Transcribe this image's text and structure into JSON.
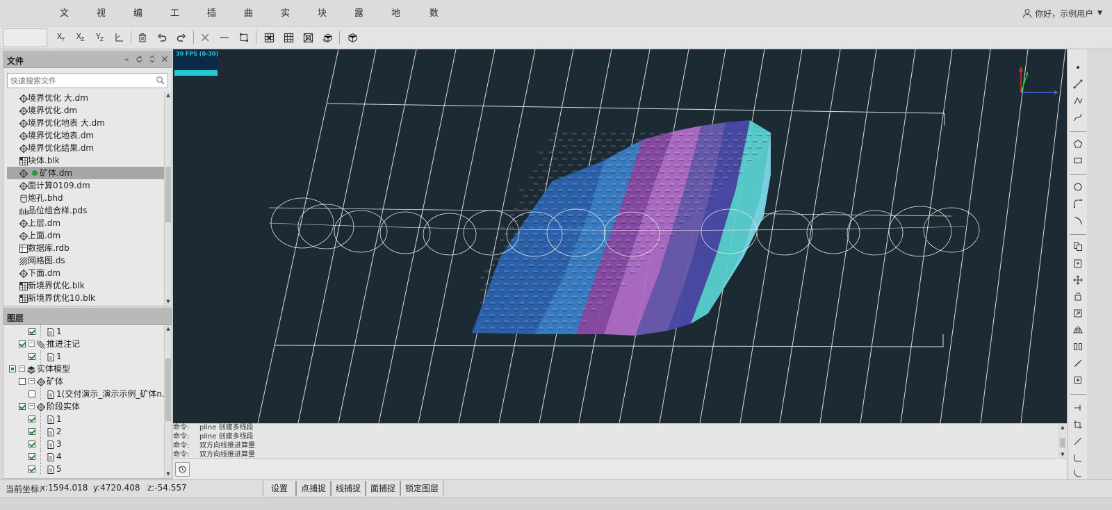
{
  "menu": {
    "items": [
      "文件",
      "视图",
      "编辑",
      "工具",
      "插入",
      "曲面",
      "实体",
      "块体",
      "露天",
      "地采",
      "数据库"
    ]
  },
  "user": {
    "greeting": "你好，示例用户"
  },
  "toolbar": {
    "buttons": [
      "xy-plane",
      "xz-plane",
      "yz-plane",
      "axis-toggle",
      "delete",
      "undo",
      "redo",
      "cross",
      "line",
      "rectangle-select",
      "view-grid",
      "grid",
      "box",
      "3d-rotate",
      "cube"
    ]
  },
  "file_panel": {
    "title": "文件",
    "search_placeholder": "快速搜索文件",
    "items": [
      {
        "name": "境界优化 大.dm",
        "icon": "dm-icon"
      },
      {
        "name": "境界优化.dm",
        "icon": "dm-icon"
      },
      {
        "name": "境界优化地表 大.dm",
        "icon": "dm-icon"
      },
      {
        "name": "境界优化地表.dm",
        "icon": "dm-icon"
      },
      {
        "name": "境界优化结果.dm",
        "icon": "dm-icon"
      },
      {
        "name": "块体.blk",
        "icon": "blk-icon"
      },
      {
        "name": "矿体.dm",
        "icon": "dm-icon",
        "selected": true,
        "active": true
      },
      {
        "name": "面计算0109.dm",
        "icon": "dm-icon"
      },
      {
        "name": "炮孔.bhd",
        "icon": "bhd-icon"
      },
      {
        "name": "品位组合样.pds",
        "icon": "pds-icon"
      },
      {
        "name": "上层.dm",
        "icon": "dm-icon"
      },
      {
        "name": "上面.dm",
        "icon": "dm-icon"
      },
      {
        "name": "数据库.rdb",
        "icon": "rdb-icon"
      },
      {
        "name": "网格图.ds",
        "icon": "ds-icon"
      },
      {
        "name": "下面.dm",
        "icon": "dm-icon"
      },
      {
        "name": "新境界优化.blk",
        "icon": "blk-icon"
      },
      {
        "name": "新境界优化10.blk",
        "icon": "blk-icon"
      }
    ]
  },
  "layer_panel": {
    "title": "图层",
    "rows": [
      {
        "label": "1",
        "indent": 2,
        "checked": "checked",
        "icon": "doc-icon",
        "expander": ""
      },
      {
        "label": "推进注记",
        "indent": 1,
        "checked": "checked",
        "icon": "hatch-icon",
        "expander": "−"
      },
      {
        "label": "1",
        "indent": 2,
        "checked": "checked",
        "icon": "doc-icon",
        "expander": ""
      },
      {
        "label": "实体模型",
        "indent": 0,
        "checked": "partial",
        "icon": "layers-icon",
        "expander": "−"
      },
      {
        "label": "矿体",
        "indent": 1,
        "checked": "unchecked",
        "icon": "dm-icon",
        "expander": "−"
      },
      {
        "label": "1(交付演示_演示示例_矿体n...",
        "indent": 2,
        "checked": "unchecked",
        "icon": "doc-icon",
        "expander": ""
      },
      {
        "label": "阶段实体",
        "indent": 1,
        "checked": "checked",
        "icon": "dm-icon",
        "expander": "−"
      },
      {
        "label": "1",
        "indent": 2,
        "checked": "checked",
        "icon": "doc-icon",
        "expander": ""
      },
      {
        "label": "2",
        "indent": 2,
        "checked": "checked",
        "icon": "doc-icon",
        "expander": ""
      },
      {
        "label": "3",
        "indent": 2,
        "checked": "checked",
        "icon": "doc-icon",
        "expander": ""
      },
      {
        "label": "4",
        "indent": 2,
        "checked": "checked",
        "icon": "doc-icon",
        "expander": ""
      },
      {
        "label": "5",
        "indent": 2,
        "checked": "checked",
        "icon": "doc-icon",
        "expander": ""
      }
    ]
  },
  "viewport": {
    "fps": "30 FPS (0-30)",
    "background": "#1c2b33",
    "ore_colors": [
      "#2a63b0",
      "#3a7ec8",
      "#8a4aa8",
      "#b06bc8",
      "#6a5ab0",
      "#9a8ad0",
      "#4a4aa8",
      "#5ad0d0",
      "#7ad8e8"
    ]
  },
  "command_area": {
    "lines": [
      {
        "prefix": "命令:",
        "text": "pline 创建多线段"
      },
      {
        "prefix": "命令:",
        "text": "pline 创建多线段"
      },
      {
        "prefix": "命令:",
        "text": "双方向线推进算量"
      },
      {
        "prefix": "命令:",
        "text": "双方向线推进算量"
      }
    ]
  },
  "status": {
    "coord_label": "当前坐标:",
    "x": "x:1594.018",
    "y": "y:4720.408",
    "z": "z:-54.557",
    "buttons": [
      "设置",
      "点捕捉",
      "线捕捉",
      "面捕捉",
      "锁定图层"
    ]
  }
}
